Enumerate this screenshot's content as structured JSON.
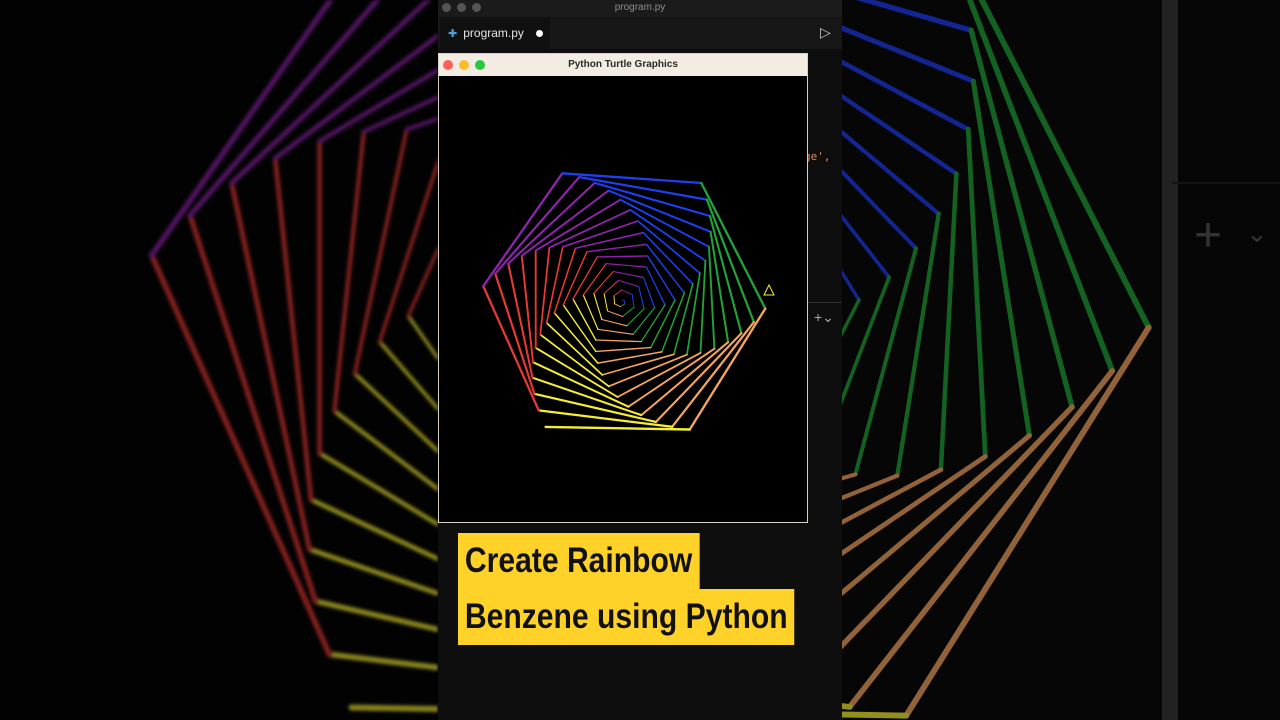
{
  "editor": {
    "window_title": "program.py",
    "tab_label": "program.py",
    "tab_icon": "python-file-icon",
    "run_icon": "▷",
    "code_fragment": "ge',"
  },
  "turtle_window": {
    "title": "Python Turtle Graphics",
    "lights": [
      "#ff5f57",
      "#febc2e",
      "#28c840"
    ]
  },
  "caption": {
    "line1": "Create Rainbow",
    "line2": "Benzene using Python",
    "background": "#ffd22a"
  },
  "artwork": {
    "colors": [
      "#e53935",
      "#8e24aa",
      "#1e3ff0",
      "#22a33a",
      "#f4a460",
      "#f5ee35"
    ],
    "steps": 90
  }
}
